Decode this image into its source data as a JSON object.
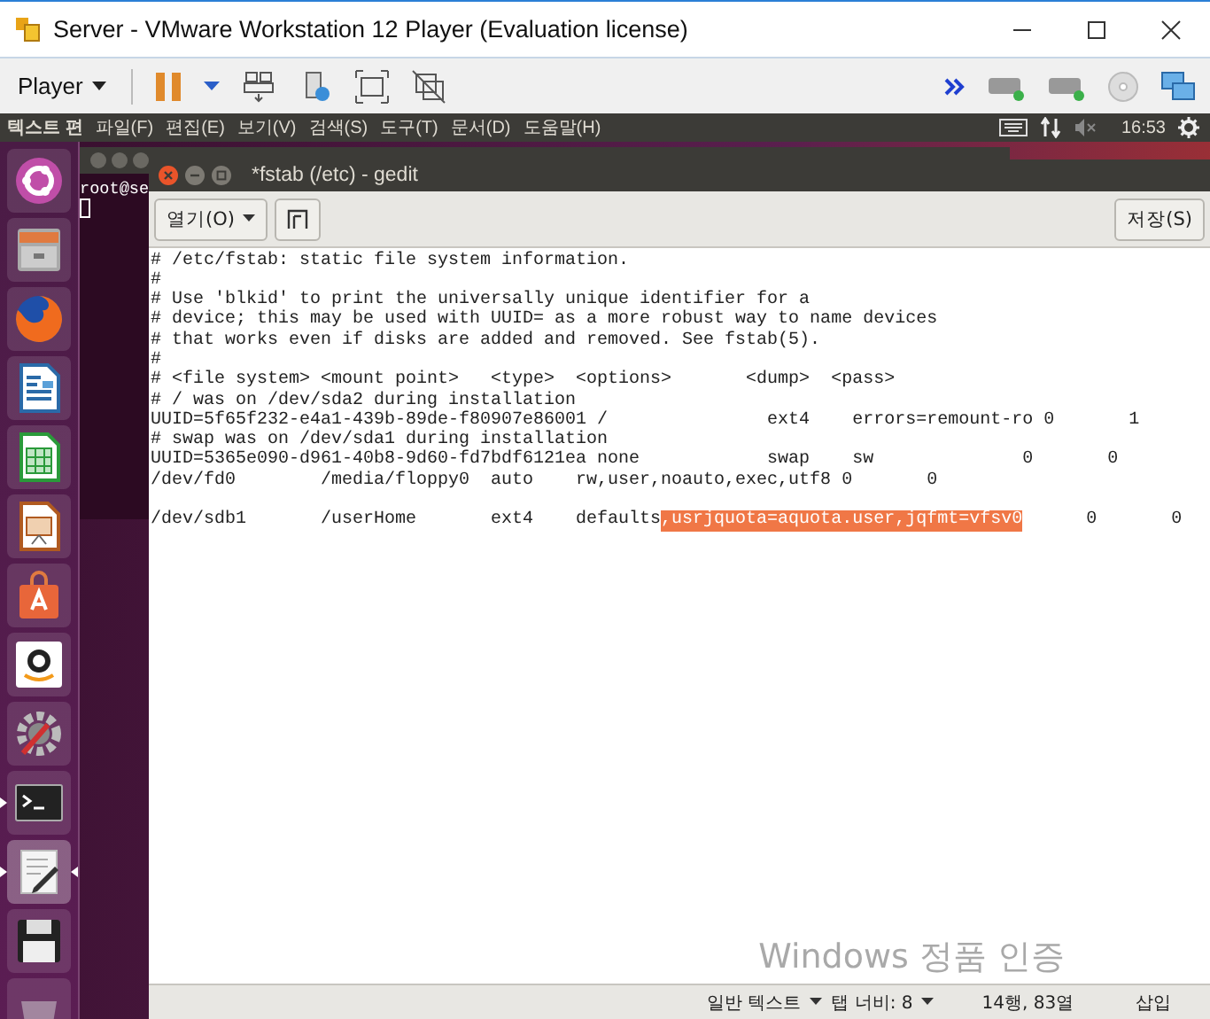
{
  "vm_window": {
    "title": "Server - VMware Workstation 12 Player (Evaluation license)"
  },
  "vm_toolbar": {
    "menu": "Player"
  },
  "top_panel": {
    "app_name": "텍스트 편",
    "menus": [
      "파일(F)",
      "편집(E)",
      "보기(V)",
      "검색(S)",
      "도구(T)",
      "문서(D)",
      "도움말(H)"
    ],
    "clock": "16:53"
  },
  "launcher": [
    {
      "kind": "ubuntu",
      "running": false,
      "selected": false
    },
    {
      "kind": "files",
      "running": false,
      "selected": false
    },
    {
      "kind": "firefox",
      "running": false,
      "selected": false
    },
    {
      "kind": "writer",
      "running": false,
      "selected": false
    },
    {
      "kind": "calc",
      "running": false,
      "selected": false
    },
    {
      "kind": "impress",
      "running": false,
      "selected": false
    },
    {
      "kind": "software",
      "running": false,
      "selected": false
    },
    {
      "kind": "amazon",
      "running": false,
      "selected": false
    },
    {
      "kind": "settings",
      "running": false,
      "selected": false
    },
    {
      "kind": "terminal",
      "running": true,
      "selected": false
    },
    {
      "kind": "editor",
      "running": true,
      "selected": true
    },
    {
      "kind": "floppy",
      "running": false,
      "selected": false
    },
    {
      "kind": "trash",
      "running": false,
      "selected": false
    }
  ],
  "terminal": {
    "prompt": "root@se"
  },
  "gedit": {
    "title": "*fstab (/etc) - gedit",
    "open_button": "열기(O)",
    "save_button": "저장(S)",
    "lines": [
      {
        "kind": "text",
        "segments": [
          {
            "text": "# /etc/fstab: static file system information.",
            "selected": false
          }
        ]
      },
      {
        "kind": "text",
        "segments": [
          {
            "text": "#",
            "selected": false
          }
        ]
      },
      {
        "kind": "text",
        "segments": [
          {
            "text": "# Use 'blkid' to print the universally unique identifier for a",
            "selected": false
          }
        ]
      },
      {
        "kind": "text",
        "segments": [
          {
            "text": "# device; this may be used with UUID= as a more robust way to name devices",
            "selected": false
          }
        ]
      },
      {
        "kind": "text",
        "segments": [
          {
            "text": "# that works even if disks are added and removed. See fstab(5).",
            "selected": false
          }
        ]
      },
      {
        "kind": "text",
        "segments": [
          {
            "text": "#",
            "selected": false
          }
        ]
      },
      {
        "kind": "text",
        "segments": [
          {
            "text": "# <file system> <mount point>   <type>  <options>       <dump>  <pass>",
            "selected": false
          }
        ]
      },
      {
        "kind": "text",
        "segments": [
          {
            "text": "# / was on /dev/sda2 during installation",
            "selected": false
          }
        ]
      },
      {
        "kind": "text",
        "segments": [
          {
            "text": "UUID=5f65f232-e4a1-439b-89de-f80907e86001 /               ext4    errors=remount-ro 0       1",
            "selected": false
          }
        ]
      },
      {
        "kind": "text",
        "segments": [
          {
            "text": "# swap was on /dev/sda1 during installation",
            "selected": false
          }
        ]
      },
      {
        "kind": "text",
        "segments": [
          {
            "text": "UUID=5365e090-d961-40b8-9d60-fd7bdf6121ea none            swap    sw              0       0",
            "selected": false
          }
        ]
      },
      {
        "kind": "text",
        "segments": [
          {
            "text": "/dev/fd0        /media/floppy0  auto    rw,user,noauto,exec,utf8 0       0",
            "selected": false
          }
        ]
      },
      {
        "kind": "blank"
      },
      {
        "kind": "text",
        "segments": [
          {
            "text": "/dev/sdb1       /userHome       ext4    defaults",
            "selected": false
          },
          {
            "text": ",usrjquota=aquota.user,jqfmt=vfsv0",
            "selected": true
          },
          {
            "text": "      0       0",
            "selected": false
          }
        ]
      }
    ],
    "status_bar": {
      "language": "일반 텍스트",
      "tab_width": "탭 너비: 8",
      "position": "14행, 83열",
      "mode": "삽입"
    }
  },
  "watermark": "Windows 정품 인증"
}
